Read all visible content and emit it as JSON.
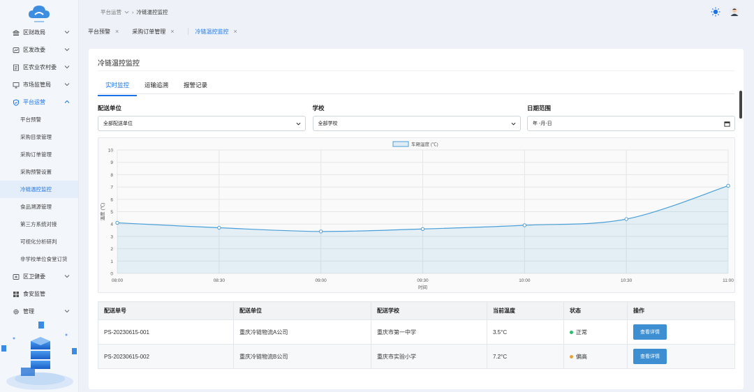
{
  "header": {
    "breadcrumb": [
      "平台运营",
      "冷链温控监控"
    ],
    "colors": {
      "accent": "#1a73e8",
      "sun": "#1a73e8"
    }
  },
  "open_tabs": [
    {
      "label": "平台预警",
      "active": false
    },
    {
      "label": "采购订单管理",
      "active": false
    },
    {
      "label": "冷链温控监控",
      "active": true
    }
  ],
  "sidebar": {
    "items": [
      {
        "label": "区财政局",
        "icon": "bank-icon"
      },
      {
        "label": "区发改委",
        "icon": "chart-icon"
      },
      {
        "label": "区农业农村委",
        "icon": "doc-icon"
      },
      {
        "label": "市场监管局",
        "icon": "monitor-icon"
      },
      {
        "label": "平台运营",
        "icon": "shield-icon",
        "active": true
      }
    ],
    "sub_items": [
      {
        "label": "平台预警"
      },
      {
        "label": "采购目录管理"
      },
      {
        "label": "采购订单管理"
      },
      {
        "label": "采购预警设置"
      },
      {
        "label": "冷链温控监控",
        "active": true
      },
      {
        "label": "食品溯源管理"
      },
      {
        "label": "第三方系统对接"
      },
      {
        "label": "可视化分析研判"
      },
      {
        "label": "非学校单位食堂订货"
      }
    ],
    "after_items": [
      {
        "label": "区卫健委",
        "icon": "plus-box-icon"
      },
      {
        "label": "食安监管",
        "icon": "grid-icon"
      },
      {
        "label": "管理",
        "icon": "gear-icon"
      }
    ]
  },
  "page": {
    "title": "冷链温控监控",
    "subtabs": [
      "实时监控",
      "运输追溯",
      "报警记录"
    ],
    "filters": {
      "unit_label": "配送单位",
      "unit_value": "全部配送单位",
      "school_label": "学校",
      "school_value": "全部学校",
      "date_label": "日期范围",
      "date_value": "年 -月-日"
    }
  },
  "chart_data": {
    "type": "area",
    "legend": "车厢温度 (℃)",
    "ylabel": "温度 (℃)",
    "xlabel": "时间",
    "x": [
      "08:00",
      "08:30",
      "09:00",
      "09:30",
      "10:00",
      "10:30",
      "11:00"
    ],
    "series": [
      {
        "name": "车厢温度 (℃)",
        "values": [
          4.1,
          3.7,
          3.4,
          3.6,
          3.9,
          4.4,
          7.1
        ]
      }
    ],
    "ylim": [
      0,
      10
    ],
    "yticks": [
      0,
      1,
      2,
      3,
      4,
      5,
      6,
      7,
      8,
      9,
      10
    ],
    "grid": true,
    "legend_position": "top-center",
    "color": "#4a9fd8"
  },
  "table": {
    "headers": [
      "配送单号",
      "配送单位",
      "配送学校",
      "当前温度",
      "状态",
      "操作"
    ],
    "rows": [
      {
        "id": "PS-20230615-001",
        "unit": "重庆冷链物流A公司",
        "school": "重庆市第一中学",
        "temp": "3.5°C",
        "status": "正常",
        "status_color": "#2ebd6b",
        "action": "查看详情"
      },
      {
        "id": "PS-20230615-002",
        "unit": "重庆冷链物流B公司",
        "school": "重庆市实验小学",
        "temp": "7.2°C",
        "status": "偏高",
        "status_color": "#e6a23c",
        "action": "查看详情"
      }
    ]
  }
}
